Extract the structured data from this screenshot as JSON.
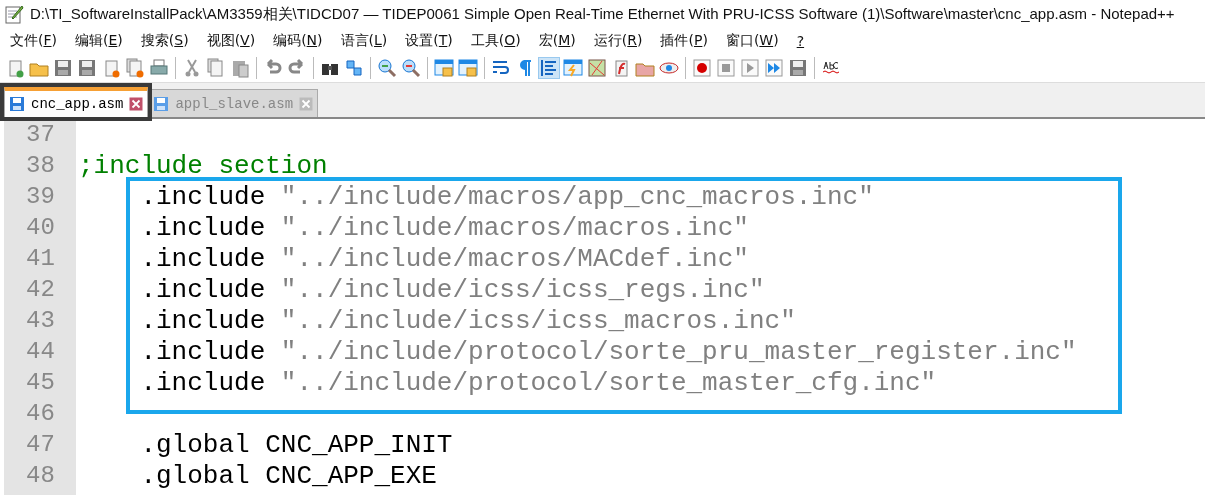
{
  "window": {
    "title": "D:\\TI_SoftwareInstallPack\\AM3359相关\\TIDCD07 — TIDEP0061 Simple Open Real-Time Ethernet With PRU-ICSS Software (1)\\Software\\master\\cnc_app.asm - Notepad++"
  },
  "menu": [
    {
      "before": "文件(",
      "key": "F",
      "after": ")"
    },
    {
      "before": "编辑(",
      "key": "E",
      "after": ")"
    },
    {
      "before": "搜索(",
      "key": "S",
      "after": ")"
    },
    {
      "before": "视图(",
      "key": "V",
      "after": ")"
    },
    {
      "before": "编码(",
      "key": "N",
      "after": ")"
    },
    {
      "before": "语言(",
      "key": "L",
      "after": ")"
    },
    {
      "before": "设置(",
      "key": "T",
      "after": ")"
    },
    {
      "before": "工具(",
      "key": "O",
      "after": ")"
    },
    {
      "before": "宏(",
      "key": "M",
      "after": ")"
    },
    {
      "before": "运行(",
      "key": "R",
      "after": ")"
    },
    {
      "before": "插件(",
      "key": "P",
      "after": ")"
    },
    {
      "before": "窗口(",
      "key": "W",
      "after": ")"
    },
    {
      "key": "?"
    }
  ],
  "tabs": [
    {
      "label": "cnc_app.asm",
      "selected": true,
      "outlined": true
    },
    {
      "label": "appl_slave.asm",
      "selected": false,
      "outlined": false
    }
  ],
  "editor": {
    "lines": [
      {
        "number": "37",
        "highlighted": false
      },
      {
        "number": "38",
        "highlighted": false,
        "segments": [
          {
            "kind": "comment",
            "text": ";include section"
          }
        ]
      },
      {
        "number": "39",
        "highlighted": true,
        "segments": [
          {
            "kind": "plain",
            "text": "    .include "
          },
          {
            "kind": "string",
            "text": "\"../include/macros/app_cnc_macros.inc\""
          }
        ]
      },
      {
        "number": "40",
        "highlighted": true,
        "segments": [
          {
            "kind": "plain",
            "text": "    .include "
          },
          {
            "kind": "string",
            "text": "\"../include/macros/macros.inc\""
          }
        ]
      },
      {
        "number": "41",
        "highlighted": true,
        "segments": [
          {
            "kind": "plain",
            "text": "    .include "
          },
          {
            "kind": "string",
            "text": "\"../include/macros/MACdef.inc\""
          }
        ]
      },
      {
        "number": "42",
        "highlighted": true,
        "segments": [
          {
            "kind": "plain",
            "text": "    .include "
          },
          {
            "kind": "string",
            "text": "\"../include/icss/icss_regs.inc\""
          }
        ]
      },
      {
        "number": "43",
        "highlighted": true,
        "segments": [
          {
            "kind": "plain",
            "text": "    .include "
          },
          {
            "kind": "string",
            "text": "\"../include/icss/icss_macros.inc\""
          }
        ]
      },
      {
        "number": "44",
        "highlighted": true,
        "segments": [
          {
            "kind": "plain",
            "text": "    .include "
          },
          {
            "kind": "string",
            "text": "\"../include/protocol/sorte_pru_master_register.inc\""
          }
        ]
      },
      {
        "number": "45",
        "highlighted": true,
        "segments": [
          {
            "kind": "plain",
            "text": "    .include "
          },
          {
            "kind": "string",
            "text": "\"../include/protocol/sorte_master_cfg.inc\""
          }
        ]
      },
      {
        "number": "46",
        "highlighted": false
      },
      {
        "number": "47",
        "highlighted": false,
        "segments": [
          {
            "kind": "plain",
            "text": "    .global CNC_APP_INIT"
          }
        ]
      },
      {
        "number": "48",
        "highlighted": false,
        "segments": [
          {
            "kind": "plain",
            "text": "    .global CNC_APP_EXE"
          }
        ]
      }
    ]
  }
}
